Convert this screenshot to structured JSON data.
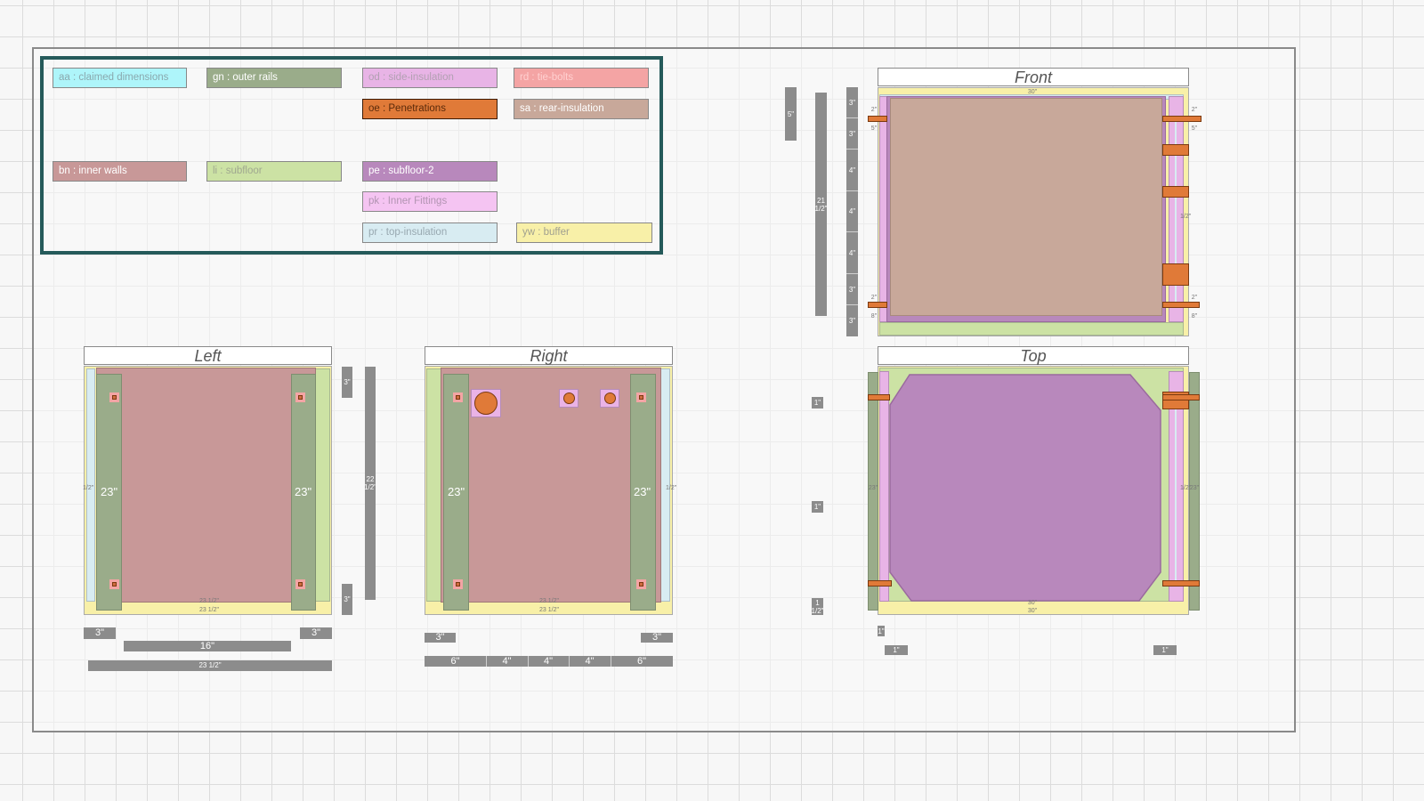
{
  "legend": [
    {
      "text": "aa : claimed dimensions",
      "color": "#aef5fa",
      "text_color": "#8aa8ae"
    },
    {
      "text": "gn : outer rails",
      "color": "#9aac8a",
      "text_color": "#ffffff"
    },
    {
      "text": "od : side-insulation",
      "color": "#e8b4e6",
      "text_color": "#b2a0b2"
    },
    {
      "text": "rd : tie-bolts",
      "color": "#f4a4a4",
      "text_color": "#ffd0d0"
    },
    {
      "text": "oe : Penetrations",
      "color": "#e07a38",
      "text_color": "#5a2a0a"
    },
    {
      "text": "sa : rear-insulation",
      "color": "#c8a89a",
      "text_color": "#ffffff"
    },
    {
      "text": "bn : inner walls",
      "color": "#c89898",
      "text_color": "#ffffff"
    },
    {
      "text": "li : subfloor",
      "color": "#cce2a4",
      "text_color": "#a0a890"
    },
    {
      "text": "pe : subfloor-2",
      "color": "#b888bc",
      "text_color": "#ffffff"
    },
    {
      "text": "pk : Inner Fittings",
      "color": "#f5c4f2",
      "text_color": "#b294b2"
    },
    {
      "text": "pr : top-insulation",
      "color": "#d8ecf2",
      "text_color": "#98a8b0"
    },
    {
      "text": "yw : buffer",
      "color": "#f8f0a8",
      "text_color": "#a0a090"
    }
  ],
  "views": {
    "left": {
      "title": "Left",
      "rail_label_left": "23\"",
      "rail_label_right": "23\"",
      "bottom_dim_1": "23 1/2\"",
      "bottom_dim_2": "23 1/2\"",
      "side_dim_v": "1/2\"",
      "vert_dim_top": "3\"",
      "vert_dim_bottom": "3\"",
      "vert_dim_total": "22 1/2\"",
      "dims_row1": [
        "3\"",
        "3\""
      ],
      "dims_row2": "16\"",
      "dims_row3": "23 1/2\""
    },
    "right": {
      "title": "Right",
      "rail_label_left": "23\"",
      "rail_label_right": "23\"",
      "bottom_dim_1": "23 1/2\"",
      "bottom_dim_2": "23 1/2\"",
      "side_dim_v": "1/2\"",
      "dims_row1": [
        "3\"",
        "3\""
      ],
      "dims_row2": [
        "6\"",
        "4\"",
        "4\"",
        "4\"",
        "6\""
      ]
    },
    "front": {
      "title": "Front",
      "top_dim": "30\"",
      "left_dims": [
        "3\"",
        "3\"",
        "4\"",
        "4\"",
        "4\"",
        "3\"",
        "3\""
      ],
      "total_dim": "21 1/2\"",
      "small_dim": "5\"",
      "corner_dims": [
        "2\"",
        "5\"",
        "2\"",
        "5\"",
        "2\"",
        "8\"",
        "2\"",
        "8\""
      ],
      "side_dim_v": "1/2\""
    },
    "top": {
      "title": "Top",
      "bottom_dim_1": "30\"",
      "bottom_dim_2": "30\"",
      "left_dims": [
        "1\"",
        "1\"",
        "1 1/2\""
      ],
      "side_dim_left": "23\"",
      "side_dim_right": "23\"",
      "side_dim_v": "1/2\"",
      "foot_dims": [
        "1\"",
        "1\"",
        "1\""
      ]
    }
  },
  "colors": {
    "rails": "#9aac8a",
    "inner_walls": "#c89898",
    "subfloor": "#cce2a4",
    "subfloor2": "#b888bc",
    "buffer": "#f8f0a8",
    "rear_insulation": "#c8a89a",
    "side_insulation": "#e8b4e6",
    "top_insulation": "#d8ecf2",
    "penetrations": "#e07a38",
    "legend_border": "#255a5a",
    "dim_bar": "#8c8c8c"
  }
}
